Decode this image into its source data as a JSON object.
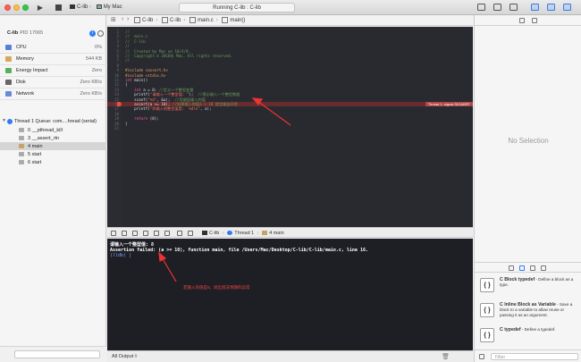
{
  "toolbar": {
    "scheme": "C-lib",
    "destination": "My Mac",
    "activity": "Running C-lib : C-lib"
  },
  "navigator": {
    "process": "C-lib",
    "pid": "PID 17065",
    "gauges": [
      {
        "label": "CPU",
        "value": "0%",
        "icon_color": "#5a7fd6"
      },
      {
        "label": "Memory",
        "value": "544 KB",
        "icon_color": "#d6a75a"
      },
      {
        "label": "Energy Impact",
        "value": "Zero",
        "icon_color": "#5ab05a"
      },
      {
        "label": "Disk",
        "value": "Zero KB/s",
        "icon_color": "#666666"
      },
      {
        "label": "Network",
        "value": "Zero KB/s",
        "icon_color": "#6a8ad6"
      }
    ],
    "thread": "Thread 1 Queue: com....hread (serial)",
    "frames": [
      {
        "label": "0 __pthread_kill",
        "icon_color": "#aaaaaa"
      },
      {
        "label": "3 __assert_rtn",
        "icon_color": "#aaaaaa"
      },
      {
        "label": "4 main",
        "icon_color": "#c8a26a"
      },
      {
        "label": "5 start",
        "icon_color": "#aaaaaa"
      },
      {
        "label": "6 start",
        "icon_color": "#aaaaaa"
      }
    ],
    "filter_placeholder": ""
  },
  "jumpbar": {
    "project": "C-lib",
    "folder": "C-lib",
    "file": "main.c",
    "symbol": "main()"
  },
  "editor": {
    "lines": [
      {
        "n": "1",
        "segs": [
          {
            "c": "com",
            "t": "//"
          }
        ]
      },
      {
        "n": "2",
        "segs": [
          {
            "c": "com",
            "t": "//  main.c"
          }
        ]
      },
      {
        "n": "3",
        "segs": [
          {
            "c": "com",
            "t": "//  C-lib"
          }
        ]
      },
      {
        "n": "4",
        "segs": [
          {
            "c": "com",
            "t": "//"
          }
        ]
      },
      {
        "n": "5",
        "segs": [
          {
            "c": "com",
            "t": "//  Created by Mac on 18/4/8."
          }
        ]
      },
      {
        "n": "6",
        "segs": [
          {
            "c": "com",
            "t": "//  Copyright © 2018年 Mac. All rights reserved."
          }
        ]
      },
      {
        "n": "7",
        "segs": [
          {
            "c": "com",
            "t": "//"
          }
        ]
      },
      {
        "n": "8",
        "segs": [
          {
            "c": "tx",
            "t": ""
          }
        ]
      },
      {
        "n": "9",
        "segs": [
          {
            "c": "pp",
            "t": "#include <assert.h>"
          }
        ]
      },
      {
        "n": "10",
        "segs": [
          {
            "c": "pp",
            "t": "#include <stdio.h>"
          }
        ]
      },
      {
        "n": "11",
        "segs": [
          {
            "c": "kw",
            "t": "int "
          },
          {
            "c": "tx",
            "t": "main()"
          }
        ]
      },
      {
        "n": "12",
        "segs": [
          {
            "c": "tx",
            "t": "{"
          }
        ]
      },
      {
        "n": "13",
        "segs": [
          {
            "c": "tx",
            "t": "    "
          },
          {
            "c": "kw",
            "t": "int "
          },
          {
            "c": "tx",
            "t": "a = 0; "
          },
          {
            "c": "com",
            "t": "//定义一个整型变量"
          }
        ]
      },
      {
        "n": "14",
        "segs": [
          {
            "c": "tx",
            "t": "    printf("
          },
          {
            "c": "str",
            "t": "\"请输入一个整型值: \""
          },
          {
            "c": "tx",
            "t": ");  "
          },
          {
            "c": "com",
            "t": "//提示输入一个整型数据"
          }
        ]
      },
      {
        "n": "15",
        "segs": [
          {
            "c": "tx",
            "t": "    scanf("
          },
          {
            "c": "str",
            "t": "\"%d\""
          },
          {
            "c": "tx",
            "t": ", &a);  "
          },
          {
            "c": "com",
            "t": "//用键盘输入的值"
          }
        ]
      },
      {
        "n": "16",
        "segs": [
          {
            "c": "tx",
            "t": "    assert(a >= 10); "
          },
          {
            "c": "com",
            "t": "//如果输入的值a < 10 就会输出异常"
          }
        ]
      },
      {
        "n": "17",
        "segs": [
          {
            "c": "tx",
            "t": "    printf("
          },
          {
            "c": "str",
            "t": "\"你输入的整型值是:  %d\\n\""
          },
          {
            "c": "tx",
            "t": ", a);"
          }
        ]
      },
      {
        "n": "18",
        "segs": [
          {
            "c": "tx",
            "t": ""
          }
        ]
      },
      {
        "n": "19",
        "segs": [
          {
            "c": "tx",
            "t": "    "
          },
          {
            "c": "kw",
            "t": "return "
          },
          {
            "c": "tx",
            "t": "(0);"
          }
        ]
      },
      {
        "n": "20",
        "segs": [
          {
            "c": "tx",
            "t": "}"
          }
        ]
      },
      {
        "n": "21",
        "segs": [
          {
            "c": "tx",
            "t": ""
          }
        ]
      }
    ],
    "error_line": 15,
    "error_badge": "Thread 1: signal SIGABRT"
  },
  "debugbar": {
    "process": "C-lib",
    "thread": "Thread 1",
    "frame": "4 main"
  },
  "console": {
    "lines": [
      {
        "t": "请输入一个整型值: 8",
        "lldb": false
      },
      {
        "t": "Assertion failed: (a >= 10), function main, file /Users/Mac/Desktop/C-lib/C-lib/main.c, line 16.",
        "lldb": false
      },
      {
        "t": "(lldb) |",
        "lldb": true
      }
    ],
    "annotation": "若输入的值是8，则出现非预期的异常",
    "output_selector": "All Output ◊"
  },
  "inspector": {
    "no_selection": "No Selection",
    "library": [
      {
        "symbol": "{ }",
        "title": "C Block typedef",
        "desc": " - Define a block as a type."
      },
      {
        "symbol": "{ }",
        "title": "C Inline Block as Variable",
        "desc": " - Save a block to a variable to allow reuse or passing it as an argument."
      },
      {
        "symbol": "{ }",
        "title": "C typedef",
        "desc": " - Define a typedef."
      }
    ],
    "filter_placeholder": "Filter"
  },
  "colors": {
    "editor_bg": "#292a30",
    "console_bg": "#1e1f24",
    "error_highlight": "#9e2d2d",
    "annotation": "#e44444"
  }
}
